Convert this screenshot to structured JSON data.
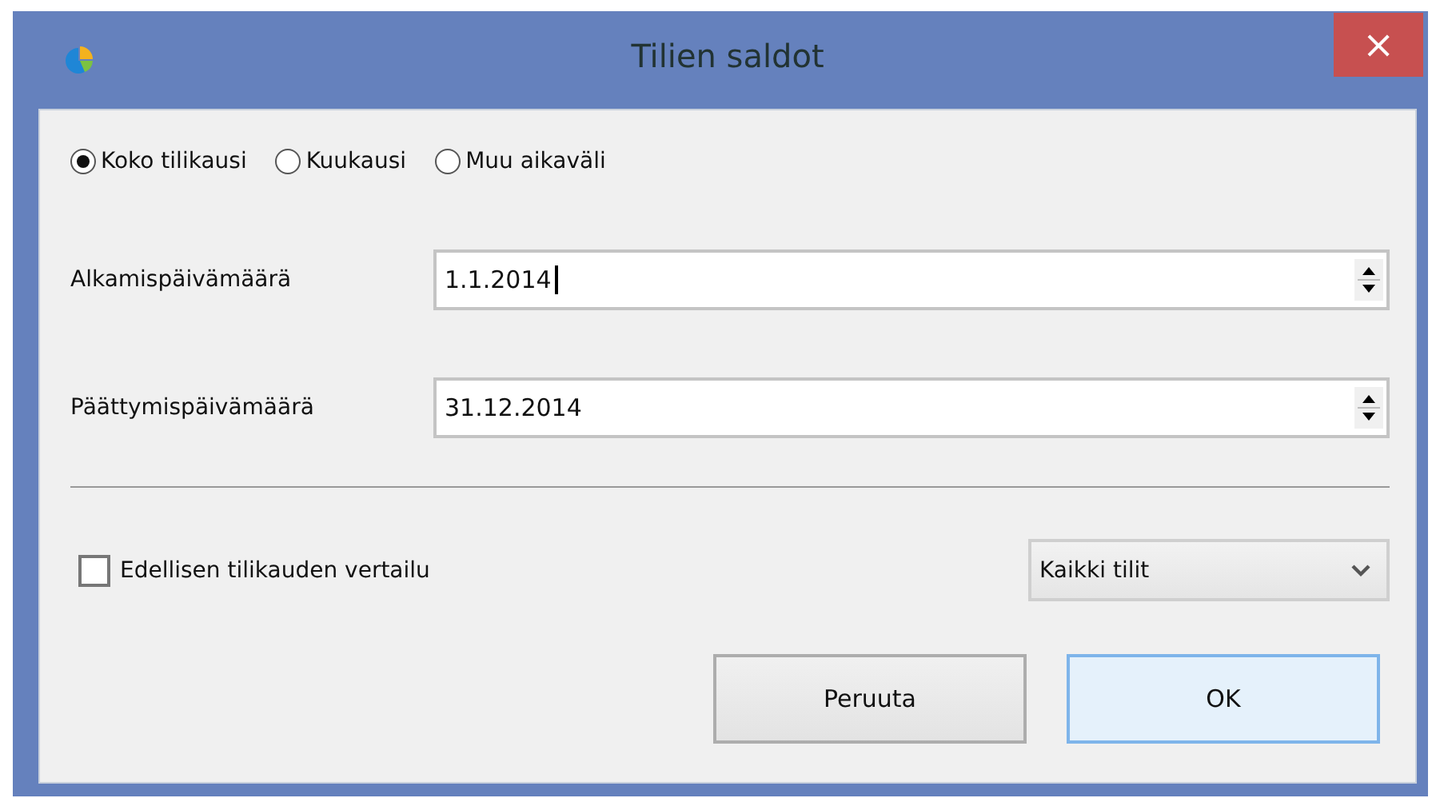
{
  "window": {
    "title": "Tilien saldot",
    "close": "×"
  },
  "period_options": [
    {
      "label": "Koko tilikausi",
      "selected": true
    },
    {
      "label": "Kuukausi",
      "selected": false
    },
    {
      "label": "Muu aikaväli",
      "selected": false
    }
  ],
  "date_fields": [
    {
      "label": "Alkamispäivämäärä",
      "value": "1.1.2014",
      "focused": true
    },
    {
      "label": "Päättymispäivämäärä",
      "value": "31.12.2014",
      "focused": false
    }
  ],
  "compare_checkbox": {
    "label": "Edellisen tilikauden vertailu",
    "checked": false
  },
  "accounts_dropdown": {
    "value": "Kaikki tilit"
  },
  "buttons": [
    {
      "label": "Peruuta",
      "default": false
    },
    {
      "label": "OK",
      "default": true
    }
  ]
}
